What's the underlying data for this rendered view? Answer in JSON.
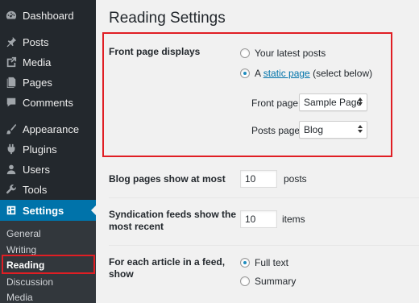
{
  "sidebar": {
    "items": [
      {
        "label": "Dashboard",
        "icon": "dashboard-icon"
      },
      {
        "label": "Posts",
        "icon": "pin-icon"
      },
      {
        "label": "Media",
        "icon": "media-icon"
      },
      {
        "label": "Pages",
        "icon": "pages-icon"
      },
      {
        "label": "Comments",
        "icon": "comment-icon"
      },
      {
        "label": "Appearance",
        "icon": "brush-icon"
      },
      {
        "label": "Plugins",
        "icon": "plugin-icon"
      },
      {
        "label": "Users",
        "icon": "user-icon"
      },
      {
        "label": "Tools",
        "icon": "wrench-icon"
      },
      {
        "label": "Settings",
        "icon": "settings-icon",
        "active": true
      }
    ],
    "submenu": [
      {
        "label": "General"
      },
      {
        "label": "Writing"
      },
      {
        "label": "Reading",
        "current": true
      },
      {
        "label": "Discussion"
      },
      {
        "label": "Media"
      }
    ]
  },
  "main": {
    "title": "Reading Settings",
    "front_page": {
      "label": "Front page displays",
      "option_latest": "Your latest posts",
      "option_static_prefix": "A",
      "option_static_link": "static page",
      "option_static_suffix": "(select below)",
      "selected": "static",
      "front_page_label": "Front page:",
      "front_page_value": "Sample Page",
      "posts_page_label": "Posts page:",
      "posts_page_value": "Blog"
    },
    "blog_pages": {
      "label": "Blog pages show at most",
      "value": "10",
      "suffix": "posts"
    },
    "syndication": {
      "label_line1": "Syndication feeds show the",
      "label_line2": "most recent",
      "value": "10",
      "suffix": "items"
    },
    "feed_article": {
      "label_line1": "For each article in a feed,",
      "label_line2": "show",
      "option_full": "Full text",
      "option_summary": "Summary",
      "selected": "full"
    }
  },
  "colors": {
    "sidebar_bg": "#23282d",
    "submenu_bg": "#32373c",
    "active_bg": "#0073aa",
    "highlight_border": "#e01e24",
    "link": "#0073aa"
  }
}
